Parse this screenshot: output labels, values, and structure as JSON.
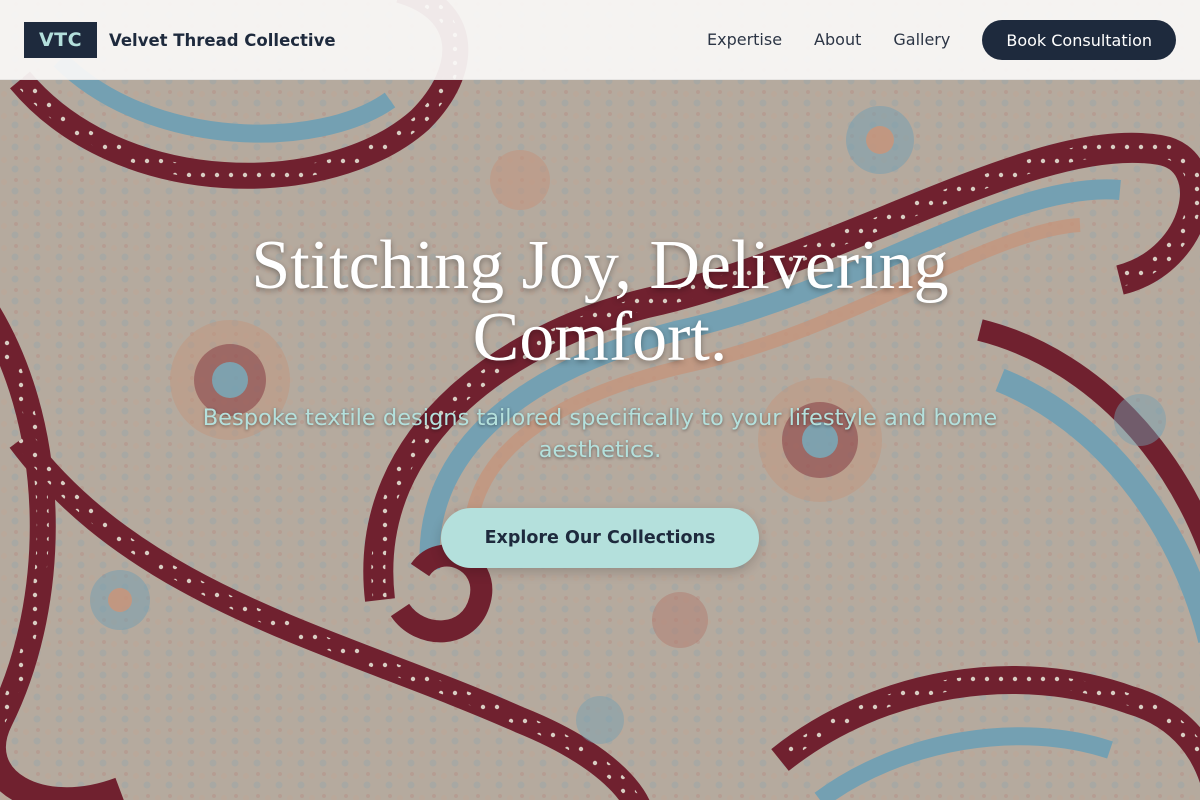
{
  "brand": {
    "logo_mark": "VTC",
    "name": "Velvet Thread Collective"
  },
  "nav": {
    "links": [
      "Expertise",
      "About",
      "Gallery"
    ],
    "cta_label": "Book Consultation"
  },
  "hero": {
    "title": "Stitching Joy, Delivering Comfort.",
    "subtitle": "Bespoke textile designs tailored specifically to your lifestyle and home aesthetics.",
    "button_label": "Explore Our Collections",
    "background_image": "paisley-fabric-pattern"
  },
  "colors": {
    "navy": "#1e2a3d",
    "mint": "#b4e0dc",
    "fabric_base": "#c8bbae",
    "paisley_red": "#8a2a36",
    "paisley_blue": "#7fb2c6",
    "paisley_peach": "#d9a58a"
  }
}
